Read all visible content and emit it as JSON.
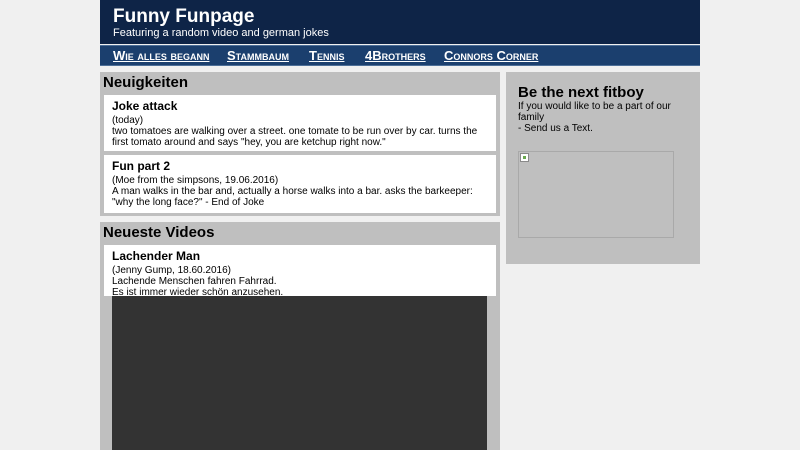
{
  "header": {
    "title": "Funny Funpage",
    "subtitle": "Featuring a random video and german jokes"
  },
  "nav": {
    "items": [
      {
        "label": "Wie alles begann"
      },
      {
        "label": "Stammbaum"
      },
      {
        "label": "Tennis"
      },
      {
        "label": "4Brothers"
      },
      {
        "label": "Connors Corner"
      }
    ]
  },
  "news": {
    "heading": "Neuigkeiten",
    "items": [
      {
        "title": "Joke attack",
        "meta": "(today)",
        "text": "two tomatoes are walking over a street. one tomate to be run over by car. turns the first tomato around and says \"hey, you are ketchup right now.\""
      },
      {
        "title": "Fun part 2",
        "meta": "(Moe from the simpsons, 19.06.2016)",
        "text": "A man walks in the bar and, actually a horse walks into a bar. asks the barkeeper: \"why the long face?\" - End of Joke"
      }
    ]
  },
  "videos": {
    "heading": "Neueste Videos",
    "items": [
      {
        "title": "Lachender Man",
        "meta": "(Jenny Gump, 18.60.2016)",
        "line1": "Lachende Menschen fahren Fahrrad.",
        "line2": "Es ist immer wieder schön anzusehen."
      }
    ]
  },
  "sidebar": {
    "heading": "Be the next fitboy",
    "text": "If you would like to be a part of our family",
    "cta": "- Send us a Text."
  }
}
